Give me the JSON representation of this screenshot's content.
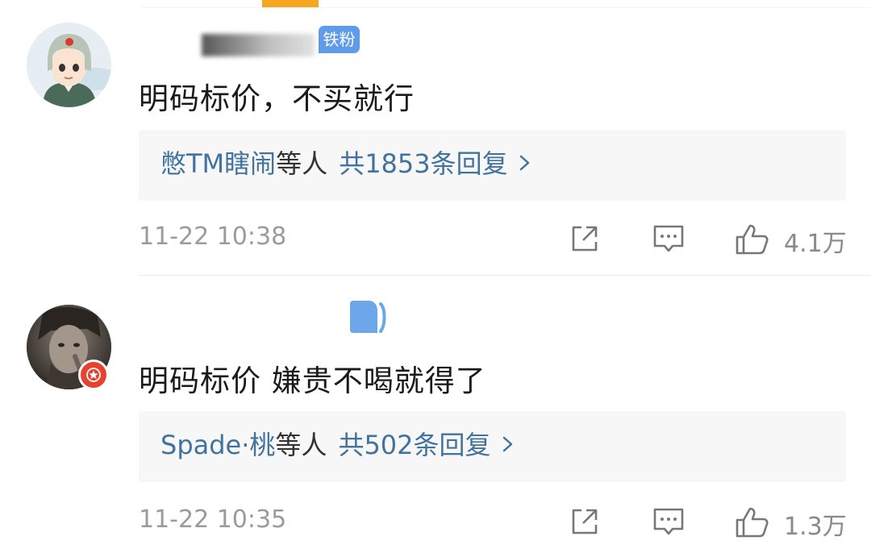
{
  "comments": [
    {
      "fan_badge": "铁粉",
      "text": "明码标价，不买就行",
      "reply": {
        "users": "憋TM瞎闹",
        "suffix": "等人",
        "count": "共1853条回复"
      },
      "time": "11-22 10:38",
      "likes": "4.1万",
      "icons": [
        "share-icon",
        "comment-icon",
        "like-icon"
      ]
    },
    {
      "text": "明码标价 嫌贵不喝就得了",
      "reply": {
        "users": "Spade·桃",
        "suffix": "等人",
        "count": "共502条回复"
      },
      "time": "11-22 10:35",
      "likes": "1.3万",
      "icons": [
        "share-icon",
        "comment-icon",
        "like-icon"
      ]
    }
  ],
  "colors": {
    "link_blue": "#41739e",
    "badge_blue": "#5f9be8",
    "verified_red": "#e8422f",
    "accent_orange": "#f5a623",
    "meta_gray": "#9b9b9b"
  }
}
